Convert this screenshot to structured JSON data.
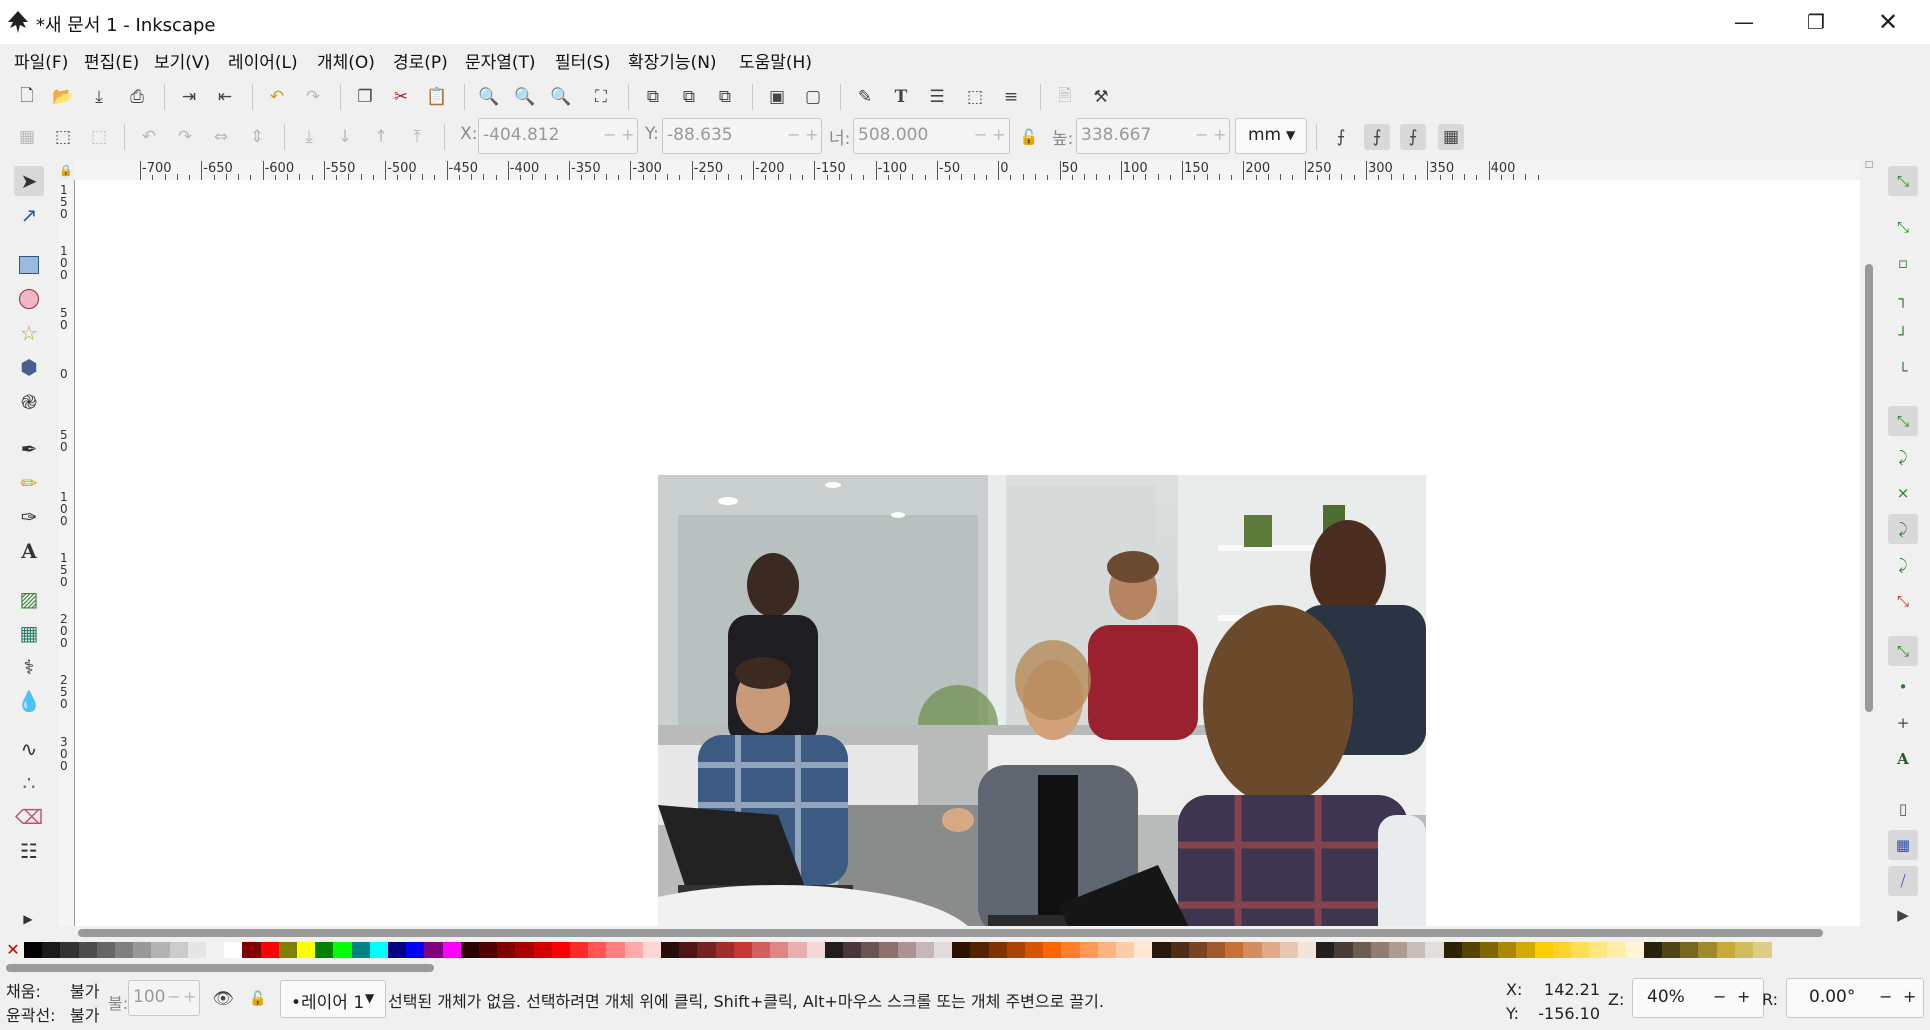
{
  "window": {
    "title": "*새 문서 1 - Inkscape",
    "minimize_icon": "minimize-icon",
    "restore_icon": "restore-icon",
    "close_icon": "close-icon"
  },
  "menu": [
    "파일(F)",
    "편집(E)",
    "보기(V)",
    "레이어(L)",
    "개체(O)",
    "경로(P)",
    "문자열(T)",
    "필터(S)",
    "확장기능(N)",
    "도움말(H)"
  ],
  "tool_controls": {
    "x_label": "X:",
    "x_value": "-404.812",
    "y_label": "Y:",
    "y_value": "-88.635",
    "w_label": "너:",
    "w_value": "508.000",
    "h_label": "높:",
    "h_value": "338.667",
    "unit": "mm"
  },
  "ruler": {
    "h_labels": [
      "-700",
      "-650",
      "-600",
      "-550",
      "-500",
      "-450",
      "-400",
      "-350",
      "-300",
      "-250",
      "-200",
      "-150",
      "-100",
      "-50",
      "0",
      "50",
      "100",
      "150",
      "200",
      "250",
      "300",
      "350",
      "400"
    ],
    "v_labels": [
      "1\n5\n0",
      "1\n0\n0",
      "5\n0",
      "0",
      "5\n0",
      "1\n0\n0",
      "1\n5\n0",
      "2\n0\n0",
      "2\n5\n0",
      "3\n0\n0"
    ]
  },
  "palette": {
    "colors": [
      "#000000",
      "#1a1a1a",
      "#333333",
      "#4d4d4d",
      "#666666",
      "#808080",
      "#999999",
      "#b3b3b3",
      "#cccccc",
      "#e6e6e6",
      "#f2f2f2",
      "#ffffff",
      "#800000",
      "#ff0000",
      "#808000",
      "#ffff00",
      "#008000",
      "#00ff00",
      "#008080",
      "#00ffff",
      "#000080",
      "#0000ff",
      "#800080",
      "#ff00ff",
      "#2b0000",
      "#550000",
      "#800000",
      "#aa0000",
      "#d40000",
      "#ff0000",
      "#ff2a2a",
      "#ff5555",
      "#ff8080",
      "#ffaaaa",
      "#ffd5d5",
      "#280b0b",
      "#501616",
      "#782121",
      "#a02c2c",
      "#c83737",
      "#d35f5f",
      "#de8787",
      "#e9afaf",
      "#f4d7d7",
      "#241c1c",
      "#483737",
      "#6c5353",
      "#916f6f",
      "#ac9393",
      "#c8b7b7",
      "#e3dbdb",
      "#2b1100",
      "#552200",
      "#803300",
      "#aa4400",
      "#d45500",
      "#ff6600",
      "#ff7f2a",
      "#ff9955",
      "#ffb380",
      "#ffccaa",
      "#ffe6d5",
      "#28170b",
      "#502d16",
      "#784421",
      "#a05a2c",
      "#c87137",
      "#d38d5f",
      "#deaa87",
      "#e9c6af",
      "#f4e3d7",
      "#241f1c",
      "#483e37",
      "#6c5d53",
      "#917c6f",
      "#ac9d93",
      "#c8beb7",
      "#e3dedb",
      "#2b2200",
      "#554400",
      "#806600",
      "#aa8800",
      "#d4aa00",
      "#ffcc00",
      "#ffd42a",
      "#ffdd55",
      "#ffe680",
      "#ffeeaa",
      "#fff6d5",
      "#28220b",
      "#504416",
      "#786721",
      "#a0892c",
      "#c8ab37",
      "#d3bc5f",
      "#decd87"
    ]
  },
  "status": {
    "fill_label": "채움:",
    "fill_value": "불가",
    "stroke_label": "윤곽선:",
    "stroke_value": "불가",
    "opacity_label": "불:",
    "opacity_value": "100",
    "layer": "•레이어 1",
    "message": "선택된 개체가 없음. 선택하려면 개체 위에 클릭, Shift+클릭, Alt+마우스 스크롤 또는 개체 주변으로 끌기.",
    "x_label": "X:",
    "x_value": "142.21",
    "y_label": "Y:",
    "y_value": "-156.10",
    "zoom_label": "Z:",
    "zoom_value": "40%",
    "rotation_label": "R:",
    "rotation_value": "0.00°"
  }
}
